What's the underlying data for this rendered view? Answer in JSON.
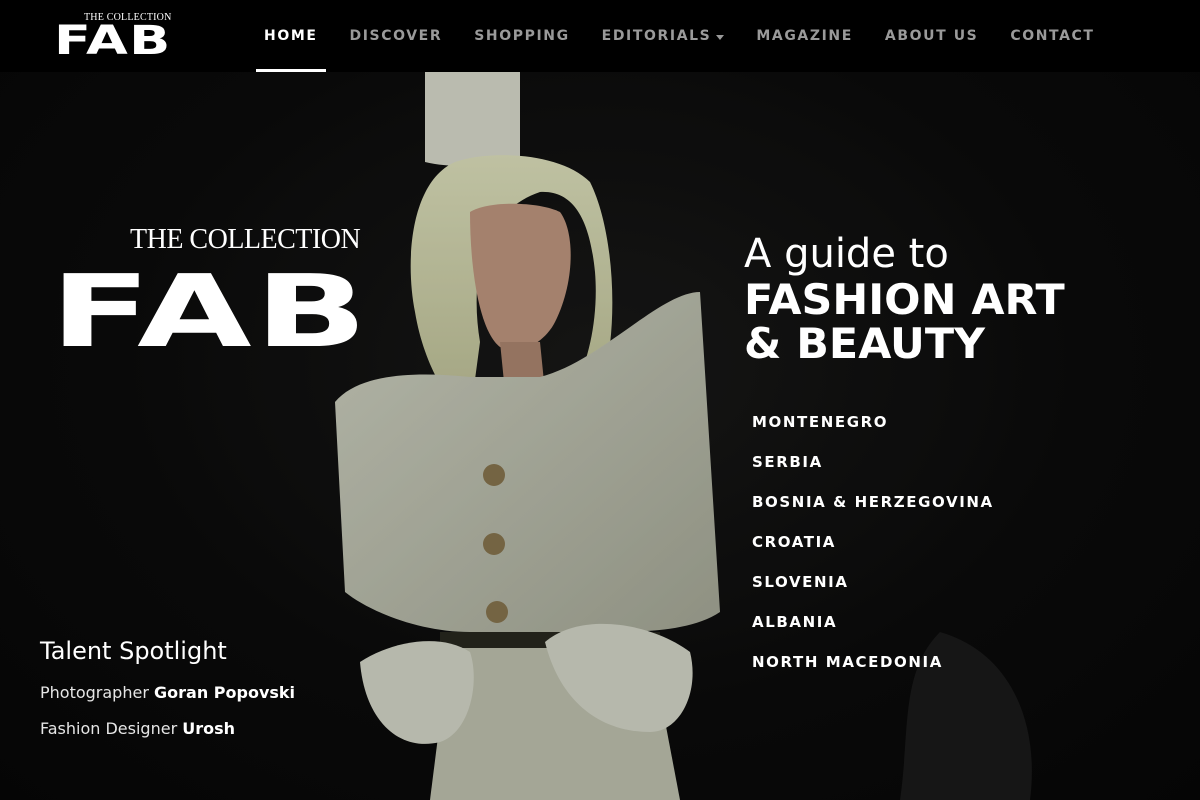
{
  "brand": {
    "small": "THE COLLECTION",
    "big": "FAB"
  },
  "nav": {
    "items": [
      {
        "label": "HOME",
        "active": true
      },
      {
        "label": "DISCOVER"
      },
      {
        "label": "SHOPPING"
      },
      {
        "label": "EDITORIALS"
      },
      {
        "label": "MAGAZINE"
      },
      {
        "label": "ABOUT US"
      },
      {
        "label": "CONTACT"
      }
    ]
  },
  "hero": {
    "logo_small": "THE COLLECTION",
    "logo_big": "FAB",
    "tagline_line1": "A guide to",
    "tagline_line2": "FASHION ART",
    "tagline_line3": "& BEAUTY",
    "regions": [
      "MONTENEGRO",
      "SERBIA",
      "BOSNIA & HERZEGOVINA",
      "CROATIA",
      "SLOVENIA",
      "ALBANIA",
      "NORTH MACEDONIA"
    ]
  },
  "spotlight": {
    "title": "Talent Spotlight",
    "credits": [
      {
        "role": "Photographer",
        "name": "Goran Popovski"
      },
      {
        "role": "Fashion Designer",
        "name": "Urosh"
      }
    ]
  },
  "colors": {
    "background": "#0b0b0b",
    "nav_bg": "#000000",
    "nav_inactive": "#9a9a9a",
    "text": "#ffffff"
  }
}
